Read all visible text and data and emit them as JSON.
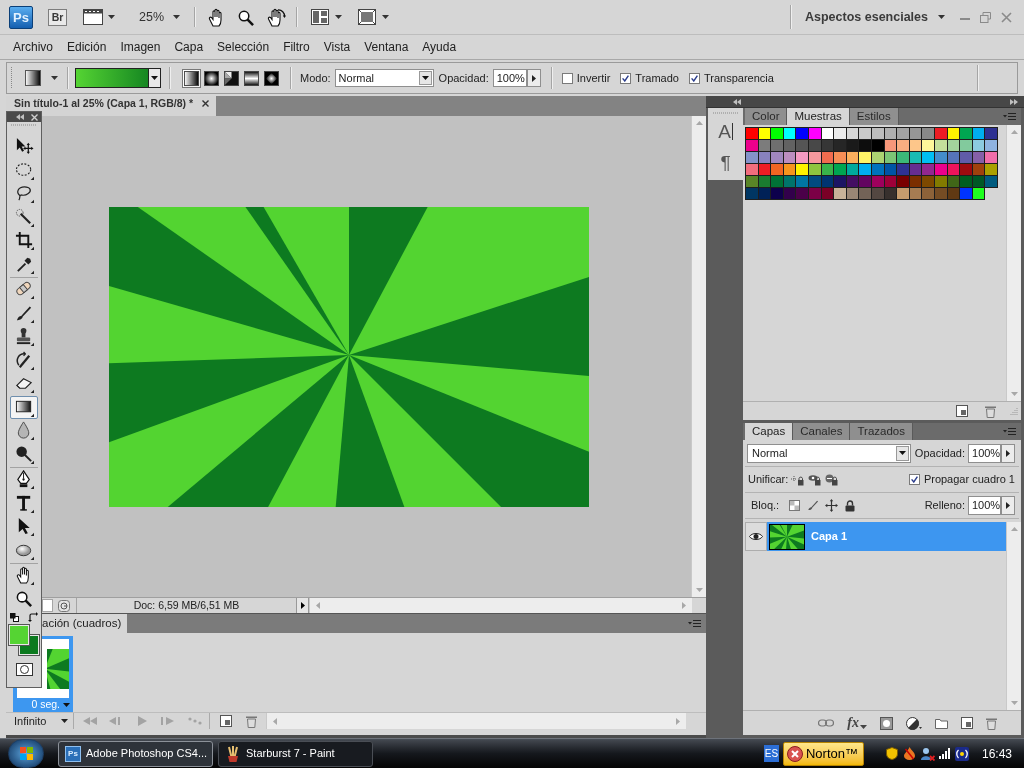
{
  "app_bar": {
    "logo": "Ps",
    "bridge": "Br",
    "zoom": "25%",
    "workspace": "Aspectos esenciales"
  },
  "menu": [
    "Archivo",
    "Edición",
    "Imagen",
    "Capa",
    "Selección",
    "Filtro",
    "Vista",
    "Ventana",
    "Ayuda"
  ],
  "options_bar": {
    "gradient_types": [
      {
        "kind": "linear",
        "selected": true
      },
      {
        "kind": "radial",
        "selected": false
      },
      {
        "kind": "angle",
        "selected": false
      },
      {
        "kind": "reflected",
        "selected": false
      },
      {
        "kind": "diamond",
        "selected": false
      }
    ],
    "mode_label": "Modo:",
    "mode": "Normal",
    "opacity_label": "Opacidad:",
    "opacity": "100%",
    "checkboxes": [
      {
        "label": "Invertir",
        "checked": false
      },
      {
        "label": "Tramado",
        "checked": true
      },
      {
        "label": "Transparencia",
        "checked": true
      }
    ]
  },
  "document": {
    "tab_title": "Sin título-1 al 25% (Capa 1, RGB/8) *",
    "doc_info": "Doc: 6,59 MB/6,51 MB"
  },
  "toolbox": {
    "groups": [
      {
        "tools": [
          {
            "kind": "move",
            "selected": false
          },
          {
            "kind": "marquee",
            "selected": false
          },
          {
            "kind": "lasso",
            "selected": false
          },
          {
            "kind": "wand",
            "selected": false
          },
          {
            "kind": "crop",
            "selected": false
          },
          {
            "kind": "eyedropper",
            "selected": false
          }
        ]
      },
      {
        "tools": [
          {
            "kind": "healing",
            "selected": false
          },
          {
            "kind": "brush",
            "selected": false
          },
          {
            "kind": "stamp",
            "selected": false
          },
          {
            "kind": "history_brush",
            "selected": false
          },
          {
            "kind": "eraser",
            "selected": false
          },
          {
            "kind": "gradient",
            "selected": true
          },
          {
            "kind": "blur",
            "selected": false
          },
          {
            "kind": "dodge",
            "selected": false
          }
        ]
      },
      {
        "tools": [
          {
            "kind": "pen",
            "selected": false
          },
          {
            "kind": "type",
            "selected": false
          },
          {
            "kind": "path_select",
            "selected": false
          },
          {
            "kind": "ellipse",
            "selected": false
          }
        ]
      },
      {
        "tools": [
          {
            "kind": "hand",
            "selected": false
          },
          {
            "kind": "zoom",
            "selected": false
          }
        ]
      }
    ],
    "colors": [
      {
        "kind": "foreground",
        "color": "#55d433"
      },
      {
        "kind": "background",
        "color": "#0b7a1f"
      }
    ]
  },
  "dock": {
    "buttons": [
      {
        "kind": "character",
        "glyph": "A"
      },
      {
        "kind": "paragraph",
        "glyph": "¶"
      }
    ]
  },
  "swatches_panel": {
    "tabs": [
      {
        "label": "Color",
        "selected": false
      },
      {
        "label": "Muestras",
        "selected": true
      },
      {
        "label": "Estilos",
        "selected": false
      }
    ],
    "swatches": [
      {
        "color": "#ff0000"
      },
      {
        "color": "#ffff00"
      },
      {
        "color": "#00ff00"
      },
      {
        "color": "#00ffff"
      },
      {
        "color": "#0000ff"
      },
      {
        "color": "#ff00ff"
      },
      {
        "color": "#ffffff"
      },
      {
        "color": "#ebebeb"
      },
      {
        "color": "#d6d6d6"
      },
      {
        "color": "#c9c9c9"
      },
      {
        "color": "#bdbdbd"
      },
      {
        "color": "#b0b0b0"
      },
      {
        "color": "#a3a3a3"
      },
      {
        "color": "#969696"
      },
      {
        "color": "#898989"
      },
      {
        "color": "#ed1c24"
      },
      {
        "color": "#fff200"
      },
      {
        "color": "#00a651"
      },
      {
        "color": "#00aeef"
      },
      {
        "color": "#2e3192"
      },
      {
        "color": "#ec008c"
      },
      {
        "color": "#7c7c7c"
      },
      {
        "color": "#6f6f6f"
      },
      {
        "color": "#626262"
      },
      {
        "color": "#555555"
      },
      {
        "color": "#484848"
      },
      {
        "color": "#363636"
      },
      {
        "color": "#262626"
      },
      {
        "color": "#1a1a1a"
      },
      {
        "color": "#0d0d0d"
      },
      {
        "color": "#000000"
      },
      {
        "color": "#f7977a"
      },
      {
        "color": "#f9ad81"
      },
      {
        "color": "#fdc68a"
      },
      {
        "color": "#fff79a"
      },
      {
        "color": "#c4df9b"
      },
      {
        "color": "#a3d39c"
      },
      {
        "color": "#82ca9d"
      },
      {
        "color": "#8ccbe0"
      },
      {
        "color": "#8fb3e0"
      },
      {
        "color": "#8493ca"
      },
      {
        "color": "#8882be"
      },
      {
        "color": "#a187be"
      },
      {
        "color": "#bc8dbf"
      },
      {
        "color": "#f49ac2"
      },
      {
        "color": "#f6989d"
      },
      {
        "color": "#f26c4f"
      },
      {
        "color": "#f68e56"
      },
      {
        "color": "#fbaf5d"
      },
      {
        "color": "#fff467"
      },
      {
        "color": "#acd372"
      },
      {
        "color": "#7cc576"
      },
      {
        "color": "#3bb878"
      },
      {
        "color": "#1abbb4"
      },
      {
        "color": "#00bff3"
      },
      {
        "color": "#438ccb"
      },
      {
        "color": "#5574b9"
      },
      {
        "color": "#605ca8"
      },
      {
        "color": "#855fa8"
      },
      {
        "color": "#f06eaa"
      },
      {
        "color": "#f26d7d"
      },
      {
        "color": "#ed1c24"
      },
      {
        "color": "#f26522"
      },
      {
        "color": "#f7941d"
      },
      {
        "color": "#fff200"
      },
      {
        "color": "#8dc63f"
      },
      {
        "color": "#39b54a"
      },
      {
        "color": "#00a651"
      },
      {
        "color": "#00a99d"
      },
      {
        "color": "#00aeef"
      },
      {
        "color": "#0072bc"
      },
      {
        "color": "#0054a6"
      },
      {
        "color": "#2e3192"
      },
      {
        "color": "#662d91"
      },
      {
        "color": "#92278f"
      },
      {
        "color": "#ec008c"
      },
      {
        "color": "#ed145b"
      },
      {
        "color": "#9e0b0f"
      },
      {
        "color": "#a0410d"
      },
      {
        "color": "#aba000"
      },
      {
        "color": "#598527"
      },
      {
        "color": "#1a7b30"
      },
      {
        "color": "#007236"
      },
      {
        "color": "#00746b"
      },
      {
        "color": "#0076a3"
      },
      {
        "color": "#004b80"
      },
      {
        "color": "#003471"
      },
      {
        "color": "#1b1464"
      },
      {
        "color": "#440e62"
      },
      {
        "color": "#630460"
      },
      {
        "color": "#9e005d"
      },
      {
        "color": "#9e0039"
      },
      {
        "color": "#790000"
      },
      {
        "color": "#7b2e00"
      },
      {
        "color": "#7d4900"
      },
      {
        "color": "#827b00"
      },
      {
        "color": "#406618"
      },
      {
        "color": "#005e20"
      },
      {
        "color": "#005826"
      },
      {
        "color": "#005b7f"
      },
      {
        "color": "#003663"
      },
      {
        "color": "#002157"
      },
      {
        "color": "#0d004c"
      },
      {
        "color": "#32004b"
      },
      {
        "color": "#4b0049"
      },
      {
        "color": "#7b0046"
      },
      {
        "color": "#7a0026"
      },
      {
        "color": "#c7b299"
      },
      {
        "color": "#998675"
      },
      {
        "color": "#736357"
      },
      {
        "color": "#534741"
      },
      {
        "color": "#37302d"
      },
      {
        "color": "#c69c6d"
      },
      {
        "color": "#a67c52"
      },
      {
        "color": "#8c6239"
      },
      {
        "color": "#754c24"
      },
      {
        "color": "#603913"
      },
      {
        "color": "#0033ff"
      },
      {
        "color": "#1fff1f"
      }
    ]
  },
  "layers_panel": {
    "tabs": [
      {
        "label": "Capas",
        "selected": true
      },
      {
        "label": "Canales",
        "selected": false
      },
      {
        "label": "Trazados",
        "selected": false
      }
    ],
    "blend_mode": "Normal",
    "opacity_label": "Opacidad:",
    "opacity": "100%",
    "unify_label": "Unificar:",
    "propagate": {
      "label": "Propagar cuadro 1",
      "checked": true
    },
    "lock_label": "Bloq.:",
    "fill_label": "Relleno:",
    "fill": "100%",
    "layers": [
      {
        "name": "Capa 1",
        "visible": true,
        "selected": true
      }
    ],
    "style_button": "fx"
  },
  "animation_panel": {
    "tab": "ación (cuadros)",
    "frames": [
      {
        "delay": "0 seg.",
        "selected": true
      }
    ],
    "loop": "Infinito"
  },
  "taskbar": {
    "tasks": [
      {
        "kind": "photoshop",
        "badge": "Ps",
        "label": "Adobe Photoshop CS4...",
        "selected": true
      },
      {
        "kind": "paint",
        "label": "Starburst 7 - Paint",
        "selected": false
      }
    ],
    "language": "ES",
    "alert": "Norton™",
    "clock": "16:43"
  }
}
